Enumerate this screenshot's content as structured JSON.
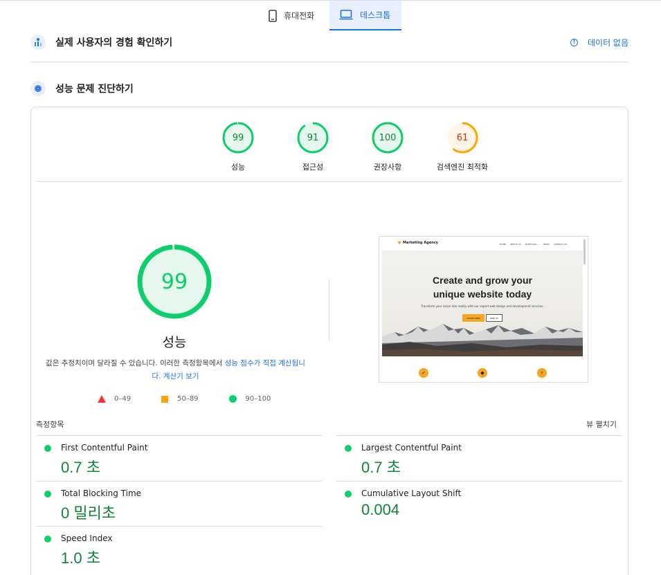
{
  "tabs": [
    {
      "label": "휴대전화",
      "icon": "phone-icon",
      "active": false
    },
    {
      "label": "데스크톱",
      "icon": "desktop-icon",
      "active": true
    }
  ],
  "field_data": {
    "title": "실제 사용자의 경험 확인하기",
    "no_data_label": "데이터 없음"
  },
  "diagnose": {
    "title": "성능 문제 진단하기"
  },
  "categories": [
    {
      "label": "성능",
      "score": "99",
      "status": "pass"
    },
    {
      "label": "접근성",
      "score": "91",
      "status": "pass"
    },
    {
      "label": "권장사항",
      "score": "100",
      "status": "pass"
    },
    {
      "label": "검색엔진 최적화",
      "score": "61",
      "status": "average"
    }
  ],
  "performance": {
    "score": "99",
    "label": "성능",
    "description_prefix": "값은 추정치이며 달라질 수 있습니다. 이러한 측정항목에서 ",
    "description_link1": "성능 점수가 직접 계산됩니다.",
    "description_link2": "계산기 보기",
    "legend": [
      {
        "range": "0–49",
        "shape": "triangle",
        "color": "#ff3333"
      },
      {
        "range": "50–89",
        "shape": "square",
        "color": "#ffa400"
      },
      {
        "range": "90–100",
        "shape": "circle",
        "color": "#0cce6b"
      }
    ]
  },
  "thumbnail": {
    "brand": "Marketing Agency",
    "menu": [
      "HOME",
      "ABOUT US",
      "PORTFOLIO ⌄",
      "NEWS",
      "CONTACT US"
    ],
    "headline_line1": "Create and grow your",
    "headline_line2": "unique website today",
    "subtext": "Transform your vision into reality with our expert web design and development services.",
    "btn_primary": "LEARN MORE",
    "btn_secondary": "HIRE US"
  },
  "metrics": {
    "header": "측정항목",
    "expand_label": "뷰 펼치기",
    "items": [
      {
        "name": "First Contentful Paint",
        "value": "0.7 초"
      },
      {
        "name": "Largest Contentful Paint",
        "value": "0.7 초"
      },
      {
        "name": "Total Blocking Time",
        "value": "0 밀리초"
      },
      {
        "name": "Cumulative Layout Shift",
        "value": "0.004"
      },
      {
        "name": "Speed Index",
        "value": "1.0 초"
      }
    ]
  },
  "colors": {
    "pass": "#0cce6b",
    "average": "#ffa400",
    "fail": "#ff3333",
    "link": "#1a73e8"
  }
}
